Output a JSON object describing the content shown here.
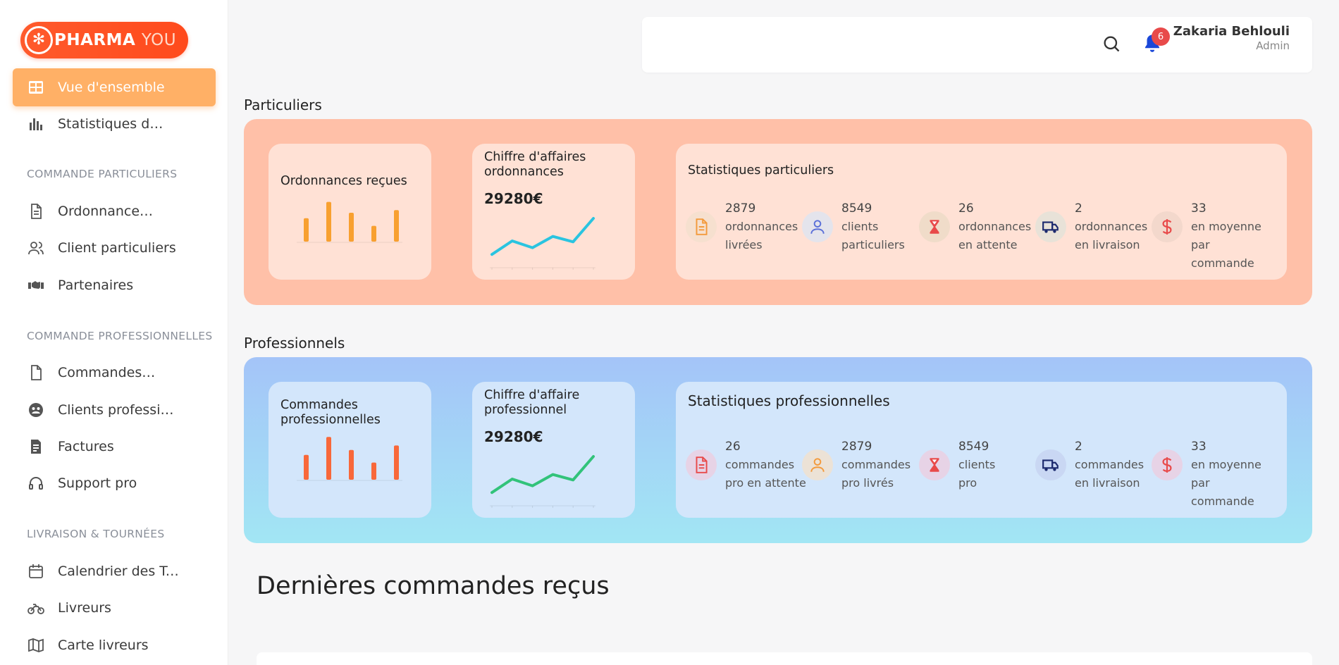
{
  "app": {
    "logo_mark": "✻",
    "logo_text_a": "PHARMA",
    "logo_text_b": "YOU"
  },
  "sidebar": {
    "items": [
      {
        "label": "Vue d'ensemble",
        "icon": "dashboard-icon",
        "active": true
      },
      {
        "label": "Statistiques détaillées",
        "icon": "bar-chart-icon"
      },
      {
        "label": "Ordonnance reçues",
        "icon": "document-icon"
      },
      {
        "label": "Client particuliers",
        "icon": "users-icon"
      },
      {
        "label": "Partenaires",
        "icon": "handshake-icon"
      },
      {
        "label": "Commandes reçues",
        "icon": "file-icon"
      },
      {
        "label": "Clients professionnels",
        "icon": "user-circle-icon"
      },
      {
        "label": "Factures",
        "icon": "invoice-icon"
      },
      {
        "label": "Support pro",
        "icon": "headset-icon"
      },
      {
        "label": "Calendrier des Tournées",
        "icon": "calendar-icon"
      },
      {
        "label": "Livreurs",
        "icon": "motorcycle-icon"
      },
      {
        "label": "Carte livreurs",
        "icon": "map-icon"
      }
    ],
    "sections": [
      "COMMANDE PARTICULIERS",
      "COMMANDE PROFESSIONNELLES",
      "LIVRAISON & TOURNÉES"
    ]
  },
  "header": {
    "notifications": "6",
    "user_name": "Zakaria Behlouli",
    "user_role": "Admin"
  },
  "particuliers": {
    "title": "Particuliers",
    "card1_title": "Ordonnances reçues",
    "card1_bars": [
      0.52,
      0.88,
      0.64,
      0.35,
      0.7
    ],
    "card2_title": "Chiffre d'affaires ordonnances",
    "card2_value": "29280€",
    "card2_line": [
      2,
      5,
      3.5,
      6,
      4.8,
      10
    ],
    "card3_title": "Statistiques particuliers",
    "stats": [
      {
        "num": "2879",
        "text": "ordonnances\nlivrées",
        "icon": "document-icon",
        "color": "#f39a3c",
        "bg": "#f6e0cf"
      },
      {
        "num": "8549",
        "text": "clients\nparticuliers",
        "icon": "user-icon",
        "color": "#5a6fd8",
        "bg": "#e4e4ec"
      },
      {
        "num": "26",
        "text": "ordonnances\nen attente",
        "icon": "hourglass-icon",
        "color": "#e84a4a",
        "bg": "#f0dcc9"
      },
      {
        "num": "2",
        "text": "ordonnances\nen livraison",
        "icon": "truck-icon",
        "color": "#1c2a6e",
        "bg": "#e8e2d8"
      },
      {
        "num": "33",
        "text": "en moyenne par\ncommande",
        "icon": "dollar-icon",
        "color": "#e84a4a",
        "bg": "#f3d8cc"
      }
    ]
  },
  "professionnels": {
    "title": "Professionnels",
    "card1_title": "Commandes professionnelles",
    "card1_bars": [
      0.55,
      0.95,
      0.66,
      0.38,
      0.76
    ],
    "card2_title": "Chiffre d'affaire professionnel",
    "card2_value": "29280€",
    "card2_line": [
      2,
      5,
      3.5,
      6,
      4.8,
      10
    ],
    "card3_title": "Statistiques professionnelles",
    "stats": [
      {
        "num": "26",
        "text": "commandes\npro en attente",
        "icon": "document-icon",
        "color": "#e84a4a",
        "bg": "#e7d3e6"
      },
      {
        "num": "2879",
        "text": "commandes\npro livrés",
        "icon": "user-icon",
        "color": "#f39a3c",
        "bg": "#ece2d6"
      },
      {
        "num": "8549",
        "text": "clients\npro",
        "icon": "hourglass-icon",
        "color": "#e84a4a",
        "bg": "#e7d3e6"
      },
      {
        "num": "2",
        "text": "commandes\nen livraison",
        "icon": "truck-icon",
        "color": "#1c2a6e",
        "bg": "#c9d7f3"
      },
      {
        "num": "33",
        "text": "en moyenne par\ncommande",
        "icon": "dollar-icon",
        "color": "#e84a4a",
        "bg": "#e7d3e6"
      }
    ]
  },
  "recent": {
    "title": "Dernières commandes reçus"
  }
}
